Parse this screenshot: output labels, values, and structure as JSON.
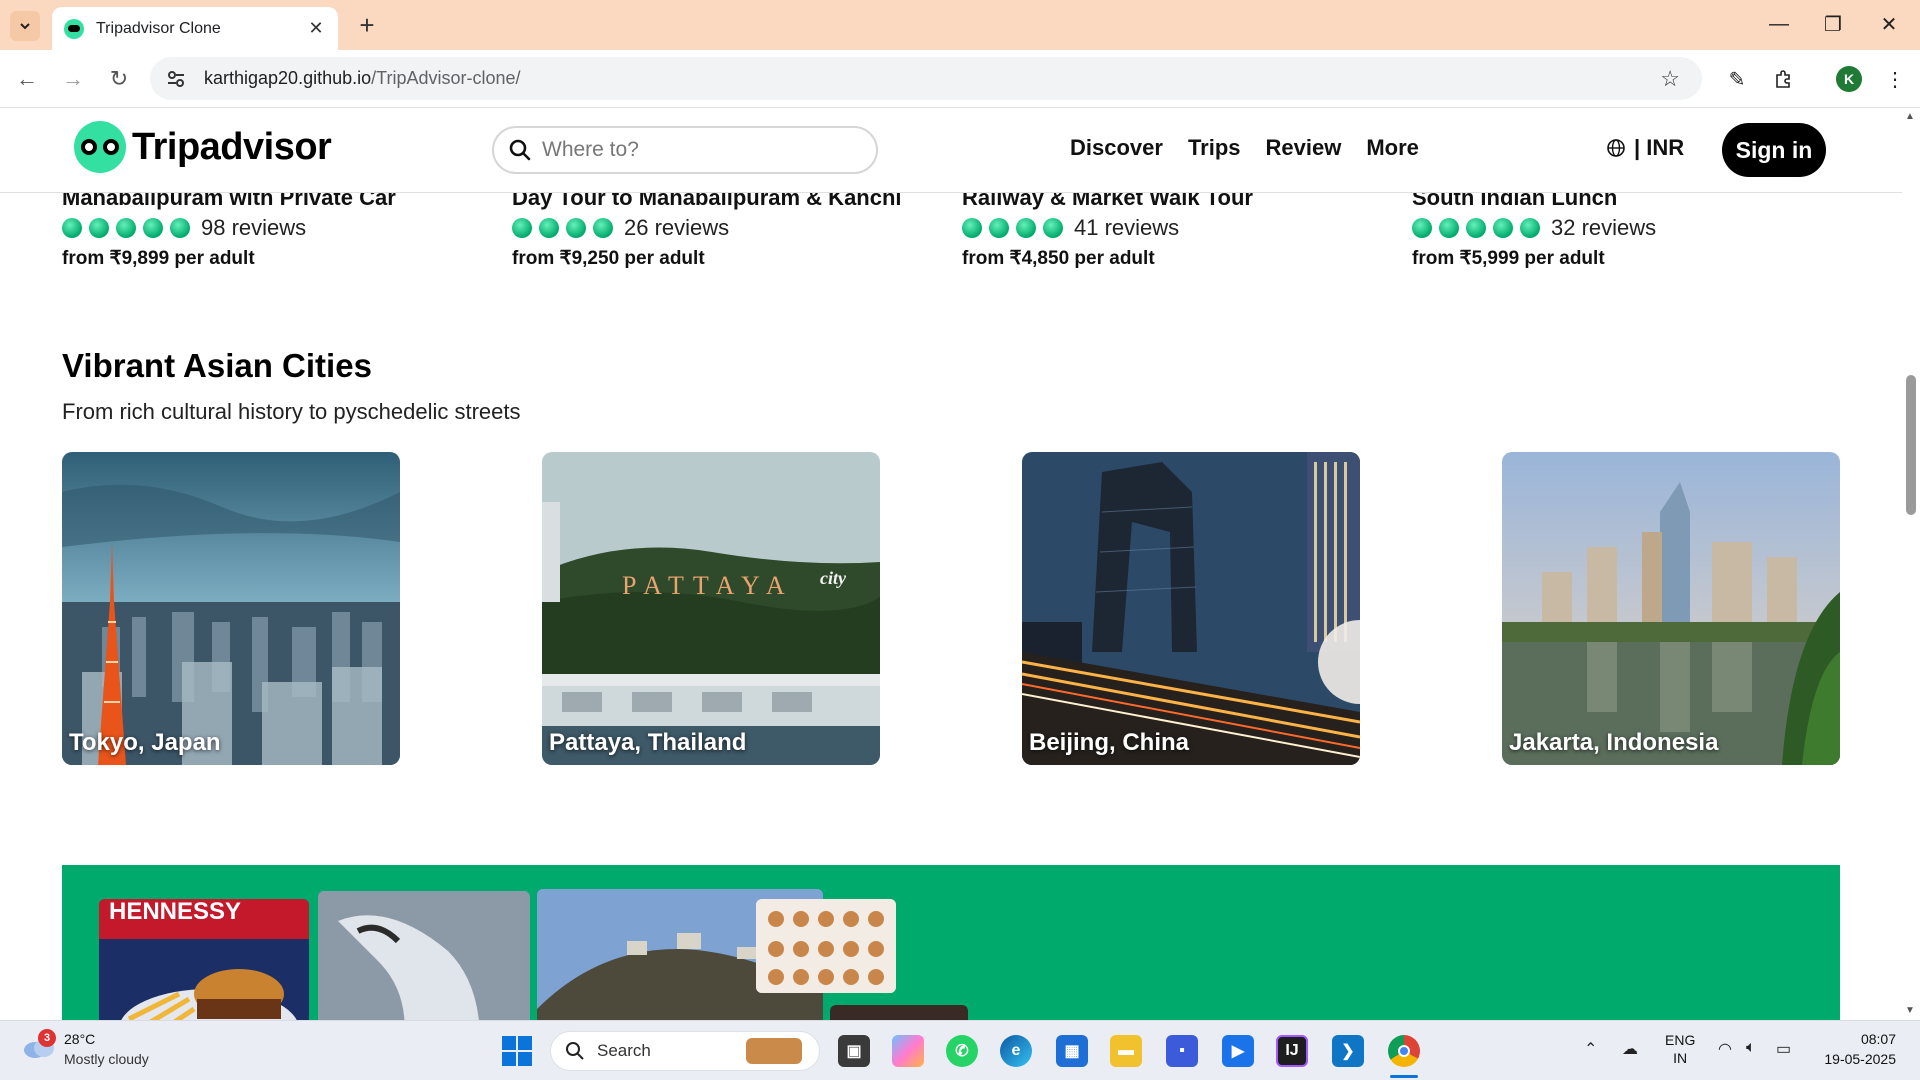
{
  "browser": {
    "tab_title": "Tripadvisor Clone",
    "url_host": "karthigap20.github.io",
    "url_path": "/TripAdvisor-clone/",
    "profile_initial": "K"
  },
  "header": {
    "logo_text": "Tripadvisor",
    "search_placeholder": "Where to?",
    "nav": [
      "Discover",
      "Trips",
      "Review",
      "More"
    ],
    "currency": "| INR",
    "signin": "Sign in"
  },
  "tours": [
    {
      "title": "Mahabalipuram with Private Car",
      "reviews": "98 reviews",
      "rating": 5,
      "price": "from ₹9,899 per adult"
    },
    {
      "title": "Day Tour to Mahabalipuram & Kanchi",
      "reviews": "26 reviews",
      "rating": 4,
      "price": "from ₹9,250 per adult"
    },
    {
      "title": "Railway & Market Walk Tour",
      "reviews": "41 reviews",
      "rating": 4,
      "price": "from ₹4,850 per adult"
    },
    {
      "title": "South Indian Lunch",
      "reviews": "32 reviews",
      "rating": 5,
      "price": "from ₹5,999 per adult"
    }
  ],
  "section": {
    "title": "Vibrant Asian Cities",
    "subtitle": "From rich cultural history to pyschedelic streets",
    "cities": [
      {
        "name": "Tokyo, Japan"
      },
      {
        "name": "Pattaya, Thailand",
        "sign_text": "PATTAYA",
        "sign_script": "city"
      },
      {
        "name": "Beijing, China"
      },
      {
        "name": "Jakarta, Indonesia"
      }
    ]
  },
  "promo": {
    "color": "#00aa6c",
    "burger_sign": "HENNESSY"
  },
  "taskbar": {
    "weather_badge": "3",
    "weather_temp": "28°C",
    "weather_desc": "Mostly cloudy",
    "search_label": "Search",
    "lang_1": "ENG",
    "lang_2": "IN",
    "time": "08:07",
    "date": "19-05-2025"
  },
  "colors": {
    "brand_green": "#34e0a1",
    "rating_green": "#00aa6c",
    "tab_strip": "#fbd9c0"
  }
}
